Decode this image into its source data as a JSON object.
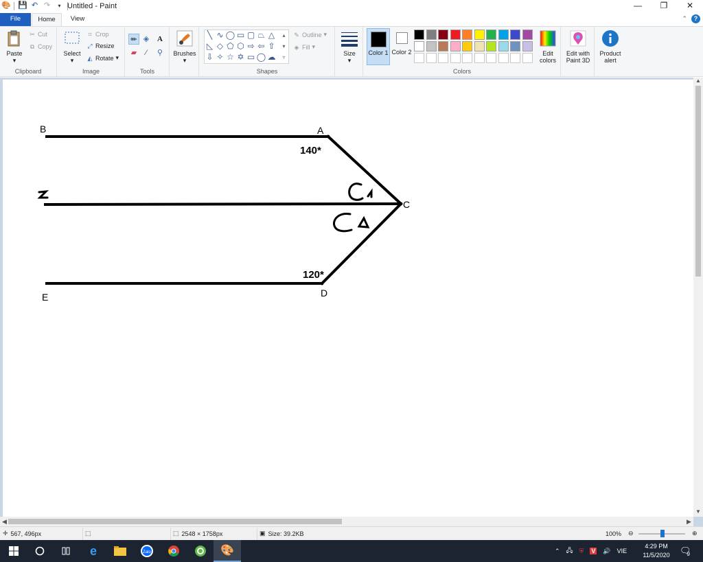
{
  "app": {
    "title": "Untitled - Paint",
    "window_buttons": {
      "minimize": "—",
      "restore": "❐",
      "close": "✕"
    }
  },
  "tabs": {
    "file": "File",
    "home": "Home",
    "view": "View"
  },
  "ribbon": {
    "clipboard": {
      "label": "Clipboard",
      "paste": "Paste",
      "cut": "Cut",
      "copy": "Copy"
    },
    "image": {
      "label": "Image",
      "select": "Select",
      "crop": "Crop",
      "resize": "Resize",
      "rotate": "Rotate"
    },
    "tools": {
      "label": "Tools"
    },
    "brushes": {
      "label": "Brushes"
    },
    "shapes": {
      "label": "Shapes",
      "outline": "Outline",
      "fill": "Fill"
    },
    "size": {
      "label": "Size"
    },
    "colors": {
      "label": "Colors",
      "color1": "Color 1",
      "color2": "Color 2",
      "color1_value": "#000000",
      "color2_value": "#ffffff",
      "row1": [
        "#000000",
        "#7f7f7f",
        "#880015",
        "#ed1c24",
        "#ff7f27",
        "#fff200",
        "#22b14c",
        "#00a2e8",
        "#3f48cc",
        "#a349a4"
      ],
      "row2": [
        "#ffffff",
        "#c3c3c3",
        "#b97a57",
        "#ffaec9",
        "#ffc90e",
        "#efe4b0",
        "#b5e61d",
        "#99d9ea",
        "#7092be",
        "#c8bfe7"
      ],
      "row3": [
        "#ffffff",
        "#ffffff",
        "#ffffff",
        "#ffffff",
        "#ffffff",
        "#ffffff",
        "#ffffff",
        "#ffffff",
        "#ffffff",
        "#ffffff"
      ],
      "edit_colors": "Edit colors"
    },
    "paint3d": {
      "label": "Edit with Paint 3D"
    },
    "alert": {
      "label": "Product alert"
    }
  },
  "drawing": {
    "label_A": "A",
    "label_B": "B",
    "label_C": "C",
    "label_D": "D",
    "label_E": "E",
    "label_z": "z",
    "angle_top": "140*",
    "angle_bottom": "120*",
    "hand_c1": "C₁",
    "hand_c2": "C₂"
  },
  "status": {
    "cursor": "567, 496px",
    "dimensions": "2548 × 1758px",
    "size": "Size: 39.2KB",
    "zoom": "100%"
  },
  "taskbar": {
    "lang": "VIE",
    "time": "4:29 PM",
    "date": "11/5/2020",
    "notifications": "9"
  }
}
